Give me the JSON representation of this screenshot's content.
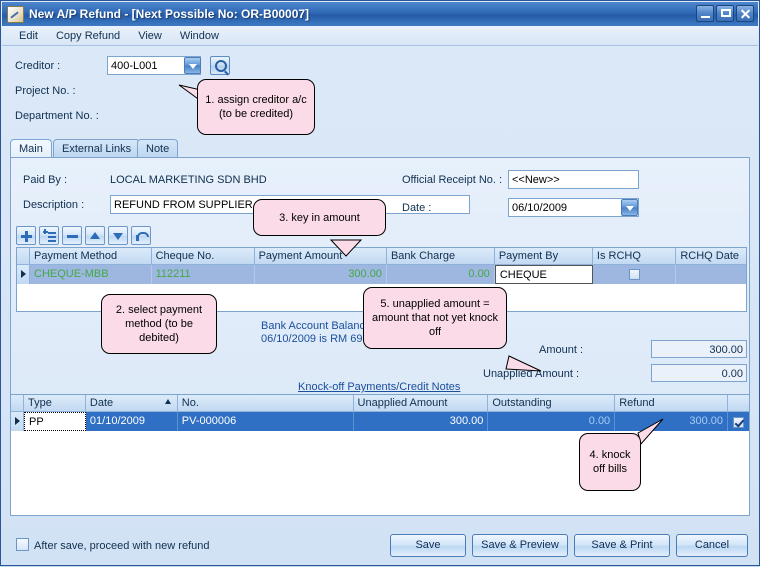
{
  "window": {
    "title": "New A/P Refund - [Next Possible No: OR-B00007]",
    "icon": "document-icon",
    "minimize": "minimize-icon",
    "maximize": "maximize-icon",
    "close": "close-icon"
  },
  "menu": {
    "items": [
      "Edit",
      "Copy Refund",
      "View",
      "Window"
    ]
  },
  "header": {
    "creditor_label": "Creditor :",
    "creditor_value": "400-L001",
    "project_label": "Project No. :",
    "project_value": "",
    "department_label": "Department No. :",
    "department_value": "",
    "search_icon": "magnifier-icon"
  },
  "tabs": [
    {
      "label": "Main",
      "active": true
    },
    {
      "label": "External Links",
      "active": false
    },
    {
      "label": "Note",
      "active": false
    }
  ],
  "main": {
    "paid_by_label": "Paid By :",
    "paid_by_value": "LOCAL MARKETING SDN BHD",
    "description_label": "Description :",
    "description_value": "REFUND FROM SUPPLIER",
    "receipt_label": "Official Receipt No. :",
    "receipt_value": "<<New>>",
    "date_label": "Date :",
    "date_value": "06/10/2009"
  },
  "grid_toolbar": [
    {
      "name": "add-row-button",
      "icon": "plus-icon"
    },
    {
      "name": "insert-row-button",
      "icon": "insert-lines-icon"
    },
    {
      "name": "delete-row-button",
      "icon": "minus-icon"
    },
    {
      "name": "move-up-button",
      "icon": "up-arrow-icon"
    },
    {
      "name": "move-down-button",
      "icon": "down-arrow-icon"
    },
    {
      "name": "undo-button",
      "icon": "undo-arrow-icon"
    }
  ],
  "payment_grid": {
    "columns": [
      "Payment Method",
      "Cheque No.",
      "Payment Amount",
      "Bank Charge",
      "Payment By",
      "Is RCHQ",
      "RCHQ Date"
    ],
    "rows": [
      {
        "payment_method": "CHEQUE-MBB",
        "cheque_no": "112211",
        "payment_amount": "300.00",
        "bank_charge": "0.00",
        "payment_by": "CHEQUE",
        "is_rchq": false,
        "rchq_date": ""
      }
    ]
  },
  "bank_info": {
    "line1": "Bank Account Balance as at",
    "line2": "06/10/2009 is RM 69,109.75"
  },
  "knockoff_link": "Knock-off Payments/Credit Notes",
  "totals": {
    "amount_label": "Amount :",
    "amount_value": "300.00",
    "unapplied_label": "Unapplied Amount :",
    "unapplied_value": "0.00"
  },
  "knockoff_grid": {
    "columns": [
      "Type",
      "Date",
      "No.",
      "Unapplied Amount",
      "Outstanding",
      "Refund"
    ],
    "sorted_column": "Date",
    "rows": [
      {
        "type": "PP",
        "date": "01/10/2009",
        "no": "PV-000006",
        "unapplied_amount": "300.00",
        "outstanding": "0.00",
        "refund": "300.00",
        "selected": true
      }
    ]
  },
  "footer": {
    "checkbox_label": "After save, proceed with new refund",
    "checkbox_checked": false,
    "buttons": [
      {
        "label": "Save",
        "name": "save-button"
      },
      {
        "label": "Save & Preview",
        "name": "save-preview-button"
      },
      {
        "label": "Save & Print",
        "name": "save-print-button"
      },
      {
        "label": "Cancel",
        "name": "cancel-button"
      }
    ]
  },
  "callouts": [
    {
      "id": 1,
      "text": "1. assign creditor a/c (to be credited)"
    },
    {
      "id": 2,
      "text": "2. select payment method (to be debited)"
    },
    {
      "id": 3,
      "text": "3. key in amount"
    },
    {
      "id": 4,
      "text": "4. knock off bills"
    },
    {
      "id": 5,
      "text": "5. unapplied amount = amount that not yet knock off"
    }
  ],
  "colors": {
    "titlebar": "#2f68b5",
    "window_bg": "#dce9f8",
    "callout_bg": "#fbdbe8",
    "grid_selected_dark": "#2f6fc4",
    "grid_selected_light": "#9db7e0",
    "link": "#1a4f9c",
    "green_text": "#45a845"
  }
}
